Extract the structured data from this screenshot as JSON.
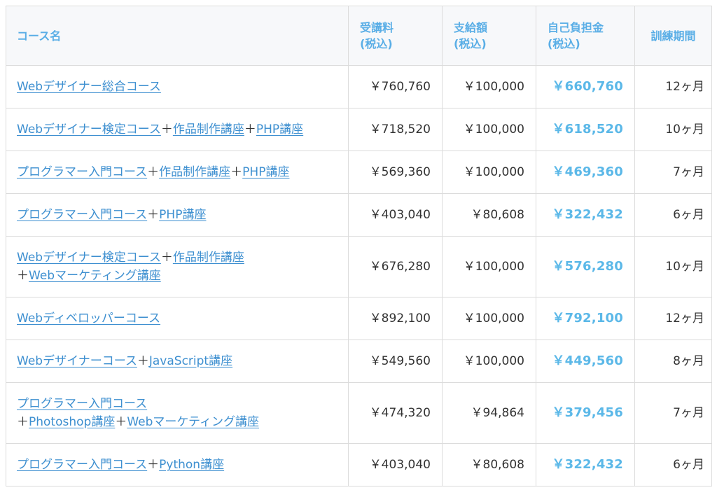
{
  "header": {
    "course_name": "コース名",
    "fee": "受講料",
    "fee_sub": "(税込)",
    "subsidy": "支給額",
    "subsidy_sub": "(税込)",
    "burden": "自己負担金",
    "burden_sub": "(税込)",
    "period": "訓練期間"
  },
  "rows": [
    {
      "lines": [
        [
          "Webデザイナー総合コース"
        ]
      ],
      "fee": "￥760,760",
      "subsidy": "￥100,000",
      "burden": "￥660,760",
      "period": "12ヶ月"
    },
    {
      "lines": [
        [
          "Webデザイナー検定コース",
          "作品制作講座",
          "PHP講座"
        ]
      ],
      "fee": "￥718,520",
      "subsidy": "￥100,000",
      "burden": "￥618,520",
      "period": "10ヶ月"
    },
    {
      "lines": [
        [
          "プログラマー入門コース",
          "作品制作講座",
          "PHP講座"
        ]
      ],
      "fee": "￥569,360",
      "subsidy": "￥100,000",
      "burden": "￥469,360",
      "period": "7ヶ月"
    },
    {
      "lines": [
        [
          "プログラマー入門コース",
          "PHP講座"
        ]
      ],
      "fee": "￥403,040",
      "subsidy": "￥80,608",
      "burden": "￥322,432",
      "period": "6ヶ月"
    },
    {
      "lines": [
        [
          "Webデザイナー検定コース",
          "作品制作講座"
        ],
        [
          "Webマーケティング講座"
        ]
      ],
      "fee": "￥676,280",
      "subsidy": "￥100,000",
      "burden": "￥576,280",
      "period": "10ヶ月"
    },
    {
      "lines": [
        [
          "Webディベロッパーコース"
        ]
      ],
      "fee": "￥892,100",
      "subsidy": "￥100,000",
      "burden": "￥792,100",
      "period": "12ヶ月"
    },
    {
      "lines": [
        [
          "Webデザイナーコース",
          "JavaScript講座"
        ]
      ],
      "fee": "￥549,560",
      "subsidy": "￥100,000",
      "burden": "￥449,560",
      "period": "8ヶ月"
    },
    {
      "lines": [
        [
          "プログラマー入門コース"
        ],
        [
          "Photoshop講座",
          "Webマーケティング講座"
        ]
      ],
      "fee": "￥474,320",
      "subsidy": "￥94,864",
      "burden": "￥379,456",
      "period": "7ヶ月"
    },
    {
      "lines": [
        [
          "プログラマー入門コース",
          "Python講座"
        ]
      ],
      "fee": "￥403,040",
      "subsidy": "￥80,608",
      "burden": "￥322,432",
      "period": "6ヶ月"
    }
  ],
  "separator": "＋",
  "colors": {
    "header_text": "#5aaee6",
    "link": "#3d8fd0",
    "burden": "#5bb8e8",
    "header_bg": "#f7f8fa"
  }
}
